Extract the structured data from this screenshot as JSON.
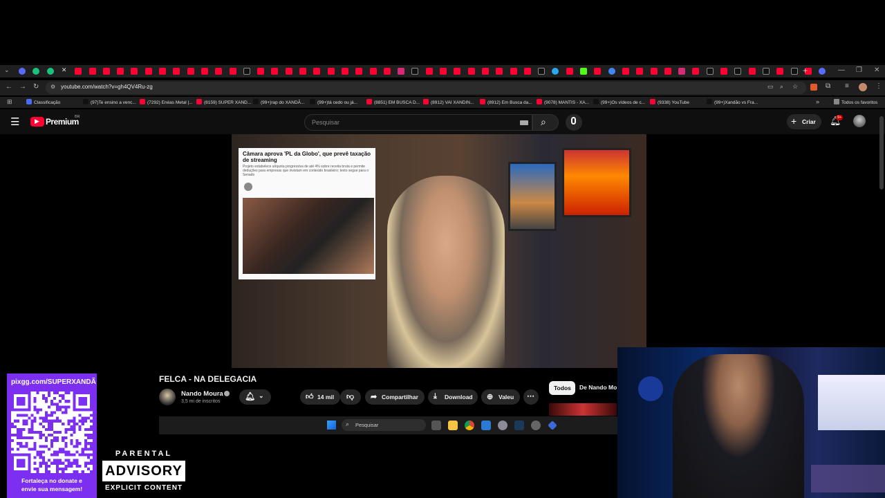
{
  "browser": {
    "url": "youtube.com/watch?v=gh4QV4Ru-zg",
    "bookmarks": [
      {
        "label": "Classificação",
        "color": "#4a6cf7"
      },
      {
        "label": "(97)Te ensino a venc...",
        "color": "#111111"
      },
      {
        "label": "(7292) Enéas Metal |...",
        "color": "#ff0033"
      },
      {
        "label": "(8159) SUPER XAND...",
        "color": "#ff0033"
      },
      {
        "label": "(99+)rap do XANDÃ...",
        "color": "#111111"
      },
      {
        "label": "(99+)tá cedo ou já...",
        "color": "#111111"
      },
      {
        "label": "(8851) EM BUSCA D...",
        "color": "#ff0033"
      },
      {
        "label": "(8912) VAI XANDIN...",
        "color": "#ff0033"
      },
      {
        "label": "(8912) Em Busca da...",
        "color": "#ff0033"
      },
      {
        "label": "(9078) MANTIS - XA...",
        "color": "#ff0033"
      },
      {
        "label": "(99+)Os vídeos de c...",
        "color": "#111111"
      },
      {
        "label": "(9338) YouTube",
        "color": "#ff0033"
      },
      {
        "label": "(99+)Xandão vs Fra...",
        "color": "#111111"
      }
    ],
    "all_bookmarks_label": "Todos os favoritos"
  },
  "youtube": {
    "logo_label": "Premium",
    "logo_region": "BR",
    "search_placeholder": "Pesquisar",
    "create_label": "Criar",
    "notification_count": "9+",
    "video_title": "FELCA - NA DELEGACIA",
    "channel_name": "Nando Moura",
    "subscribers": "3,5 mi de inscritos",
    "likes": "14 mil",
    "share_label": "Compartilhar",
    "download_label": "Download",
    "thanks_label": "Valeu",
    "chip_all": "Todos",
    "chip_channel": "De Nando Mo",
    "news_headline": "Câmara aprova 'PL da Globo', que prevê taxação de streaming",
    "news_sub": "Projeto estabelece alíquota progressiva de até 4% sobre receita bruta e permite deduções para empresas que invistam em conteúdo brasileiro; texto segue para o Senado"
  },
  "taskbar": {
    "search_placeholder": "Pesquisar"
  },
  "overlay": {
    "pix_url": "pixgg.com/SUPERXANDÃ",
    "donate_message_line1": "Fortaleça no donate e",
    "donate_message_line2": "envie sua mensagem!",
    "advisory_top": "PARENTAL",
    "advisory_main": "ADVISORY",
    "advisory_bottom": "EXPLICIT CONTENT"
  },
  "colors": {
    "youtube_red": "#ff0033",
    "donate_purple": "#7c2ff0",
    "page_bg": "#0f0f0f"
  }
}
